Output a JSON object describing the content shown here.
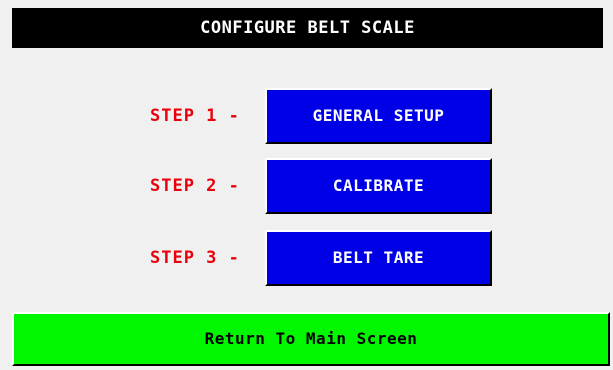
{
  "header": {
    "title": "CONFIGURE BELT SCALE"
  },
  "steps": [
    {
      "label": "STEP 1 -",
      "button": "GENERAL SETUP"
    },
    {
      "label": "STEP 2 -",
      "button": "CALIBRATE"
    },
    {
      "label": "STEP 3 -",
      "button": "BELT TARE"
    }
  ],
  "footer": {
    "return_label": "Return To Main Screen"
  },
  "colors": {
    "title_bg": "#000000",
    "step_label": "#e8000b",
    "step_button_bg": "#0000e6",
    "return_button_bg": "#00f700",
    "screen_bg": "#f0f0f0"
  }
}
